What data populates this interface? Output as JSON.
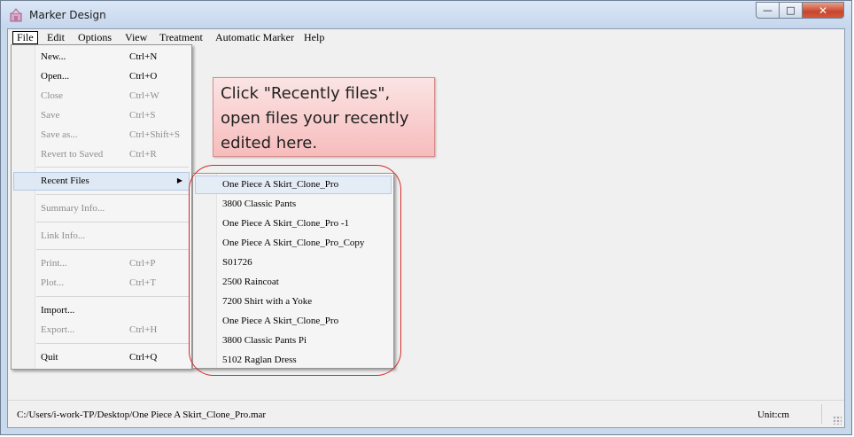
{
  "window": {
    "title": "Marker Design",
    "minimize_glyph": "—",
    "maximize_glyph": "□",
    "close_glyph": "✕"
  },
  "menubar": {
    "items": [
      "File",
      "Edit",
      "Options",
      "View",
      "Treatment",
      "Automatic Marker",
      "Help"
    ]
  },
  "file_menu": {
    "items": [
      {
        "label": "New...",
        "shortcut": "Ctrl+N"
      },
      {
        "label": "Open...",
        "shortcut": "Ctrl+O"
      },
      {
        "label": "Close",
        "shortcut": "Ctrl+W"
      },
      {
        "label": "Save",
        "shortcut": "Ctrl+S"
      },
      {
        "label": "Save as...",
        "shortcut": "Ctrl+Shift+S"
      },
      {
        "label": "Revert to Saved",
        "shortcut": "Ctrl+R"
      },
      {
        "label": "Recent Files",
        "shortcut": ""
      },
      {
        "label": "Summary Info...",
        "shortcut": ""
      },
      {
        "label": "Link Info...",
        "shortcut": ""
      },
      {
        "label": "Print...",
        "shortcut": "Ctrl+P"
      },
      {
        "label": "Plot...",
        "shortcut": "Ctrl+T"
      },
      {
        "label": "Import...",
        "shortcut": ""
      },
      {
        "label": "Export...",
        "shortcut": "Ctrl+H"
      },
      {
        "label": "Quit",
        "shortcut": "Ctrl+Q"
      }
    ]
  },
  "recent_files": [
    "One Piece A Skirt_Clone_Pro",
    "3800 Classic Pants",
    "One Piece A Skirt_Clone_Pro -1",
    "One Piece A Skirt_Clone_Pro_Copy",
    "S01726",
    "2500 Raincoat",
    "7200 Shirt with a Yoke",
    "One Piece A Skirt_Clone_Pro",
    "3800 Classic Pants Pi",
    "5102 Raglan Dress"
  ],
  "callout": {
    "line1": "Click \"Recently files\",",
    "line2": "open files your recently",
    "line3": "edited here."
  },
  "statusbar": {
    "path": "C:/Users/i-work-TP/Desktop/One Piece A Skirt_Clone_Pro.mar",
    "unit": "Unit:cm"
  },
  "colors": {
    "callout_fill": "#f7bcbc",
    "highlight_ring": "#d42a2a"
  }
}
